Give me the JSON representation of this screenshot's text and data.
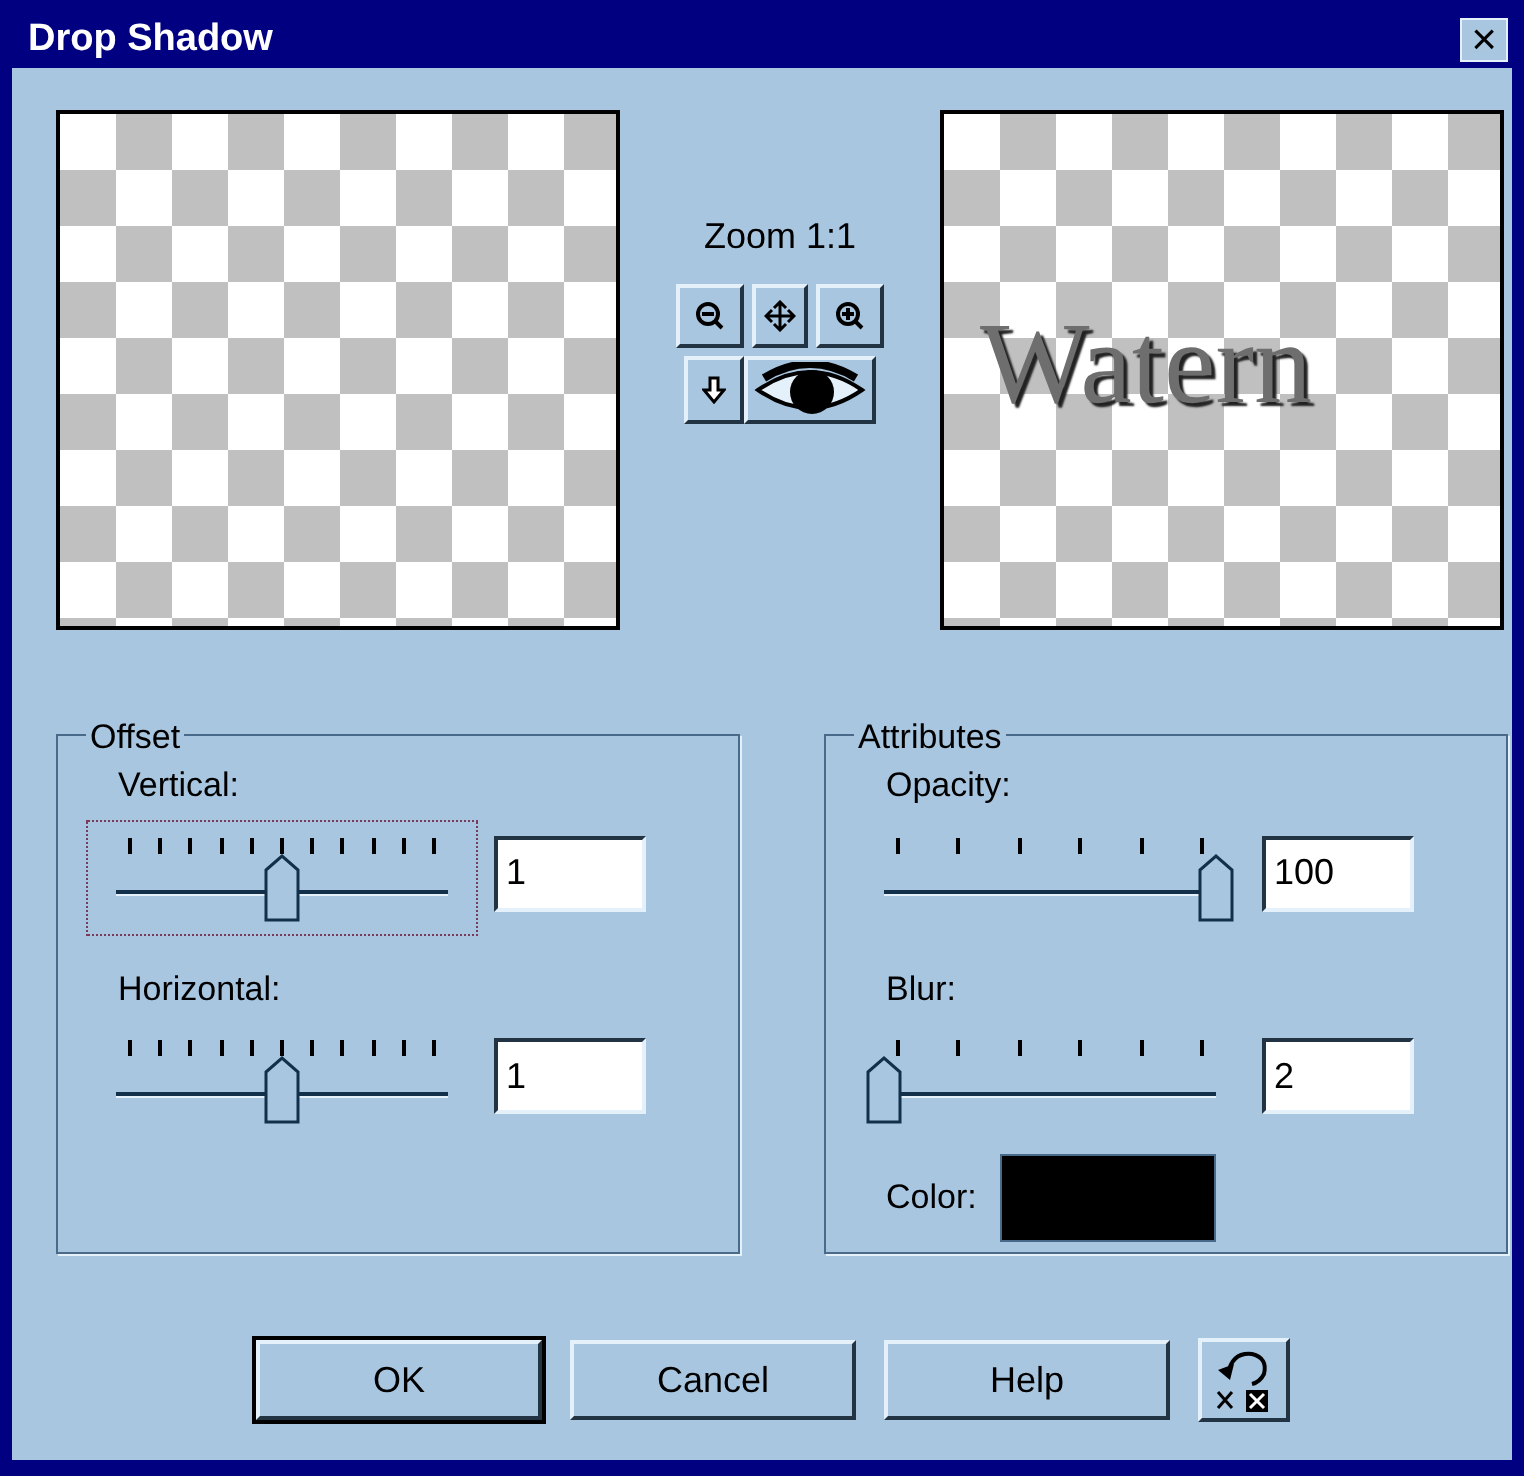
{
  "window": {
    "title": "Drop Shadow",
    "close": "×"
  },
  "preview": {
    "result_text": "Watern"
  },
  "zoom": {
    "label": "Zoom 1:1"
  },
  "offset": {
    "title": "Offset",
    "sliders": [
      {
        "label": "Vertical:",
        "level": 0.5,
        "value": "1",
        "focused": true
      },
      {
        "label": "Horizontal:",
        "level": 0.5,
        "value": "1",
        "focused": false
      }
    ]
  },
  "attributes": {
    "title": "Attributes",
    "sliders": [
      {
        "label": "Opacity:",
        "level": 1,
        "value": "100",
        "focused": false
      },
      {
        "label": "Blur:",
        "level": 0,
        "value": "2",
        "focused": false
      }
    ],
    "color_label": "Color:",
    "color": "#000000"
  },
  "buttons": [
    {
      "label": "OK",
      "default": true
    },
    {
      "label": "Cancel",
      "default": false
    },
    {
      "label": "Help",
      "default": false
    }
  ]
}
